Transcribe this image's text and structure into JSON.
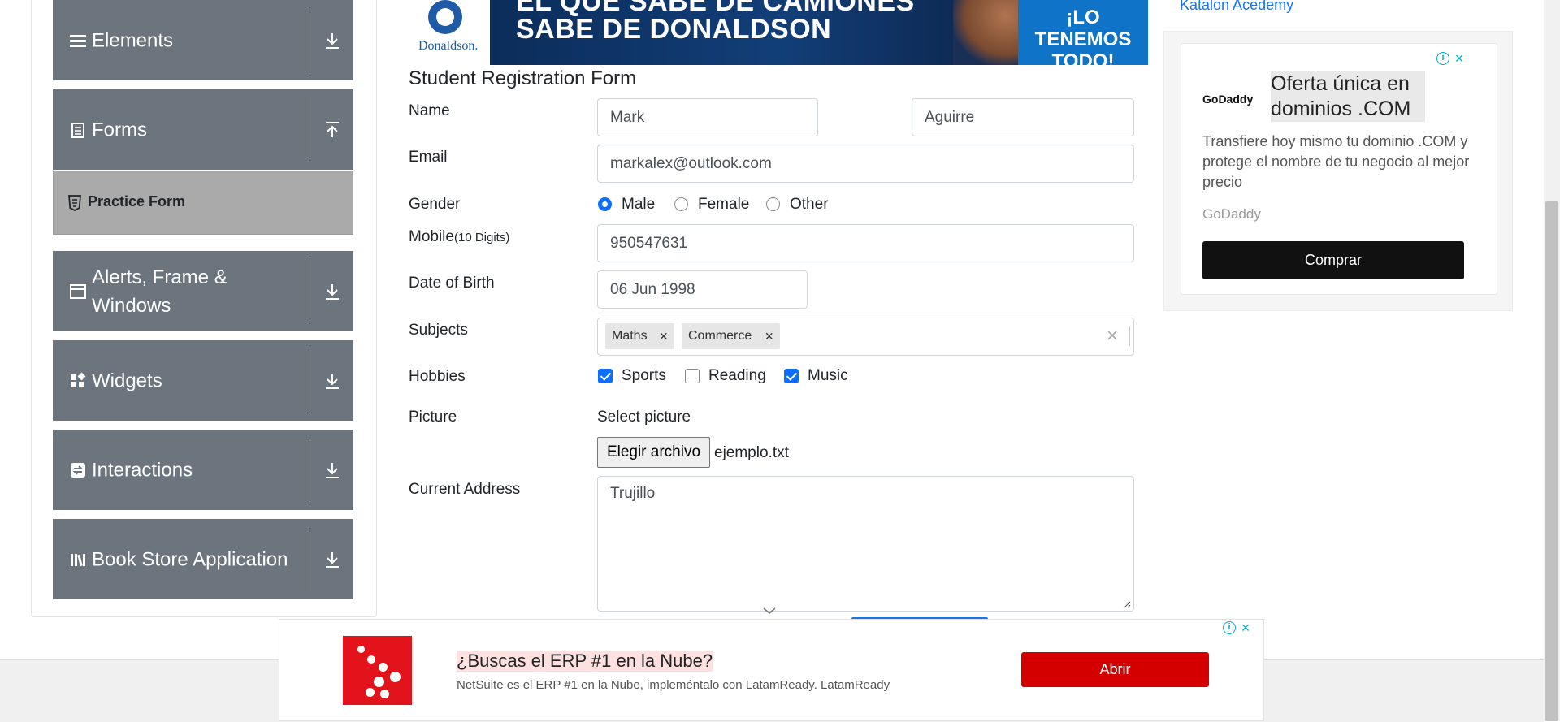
{
  "sidebar": {
    "groups": [
      {
        "label": "Elements",
        "icon": "menu-icon",
        "arrow": "expand-arrow-icon"
      },
      {
        "label": "Forms",
        "icon": "form-icon",
        "arrow": "collapse-arrow-icon"
      },
      {
        "label": "Alerts, Frame & Windows",
        "icon": "window-icon",
        "arrow": "expand-arrow-icon"
      },
      {
        "label": "Widgets",
        "icon": "widgets-icon",
        "arrow": "expand-arrow-icon"
      },
      {
        "label": "Interactions",
        "icon": "interactions-icon",
        "arrow": "expand-arrow-icon"
      },
      {
        "label": "Book Store Application",
        "icon": "books-icon",
        "arrow": "expand-arrow-icon"
      }
    ],
    "active_item": {
      "label": "Practice Form",
      "icon": "html5-icon"
    }
  },
  "banner": {
    "logo_text": "Donaldson.",
    "headline_line1": "EL QUE SABE DE CAMIONES",
    "headline_line2": "SABE DE DONALDSON",
    "cta_line1": "¡LO",
    "cta_line2": "TENEMOS",
    "cta_line3": "TODO!"
  },
  "form": {
    "title": "Student Registration Form",
    "name_label": "Name",
    "first_name": "Mark",
    "last_name": "Aguirre",
    "email_label": "Email",
    "email": "markalex@outlook.com",
    "gender_label": "Gender",
    "gender_options": [
      "Male",
      "Female",
      "Other"
    ],
    "gender_selected": "Male",
    "mobile_label": "Mobile",
    "mobile_hint": "(10 Digits)",
    "mobile": "950547631",
    "dob_label": "Date of Birth",
    "dob": "06 Jun 1998",
    "subjects_label": "Subjects",
    "subjects": [
      "Maths",
      "Commerce"
    ],
    "subjects_clear": "×",
    "chip_remove": "×",
    "hobbies_label": "Hobbies",
    "hobbies": [
      {
        "label": "Sports",
        "checked": true
      },
      {
        "label": "Reading",
        "checked": false
      },
      {
        "label": "Music",
        "checked": true
      }
    ],
    "picture_label": "Picture",
    "select_picture": "Select picture",
    "file_button": "Elegir archivo",
    "file_name": "ejemplo.txt",
    "address_label": "Current Address",
    "address": "Trujillo"
  },
  "side_ad": {
    "katalon_alt": "Katalon Acedemy",
    "brand": "GoDaddy",
    "logo_text": "GoDaddy",
    "title": "Oferta única en dominios .COM",
    "body": "Transfiere hoy mismo tu dominio .COM y protege el nombre de tu negocio al mejor precio",
    "button": "Comprar",
    "info_mark": "i",
    "close_mark": "×"
  },
  "bottom_ad": {
    "headline": "¿Buscas el ERP #1 en la Nube?",
    "sub": "NetSuite es el ERP #1 en la Nube, impleméntalo con LatamReady. LatamReady",
    "button": "Abrir",
    "info_mark": "i",
    "close_mark": "×"
  },
  "colors": {
    "sidebar_bg": "#6c757d",
    "active_item_bg": "#aaaaaa",
    "accent": "#0d6efd",
    "ad_button_dark": "#111111",
    "ad_button_red": "#d40000"
  }
}
